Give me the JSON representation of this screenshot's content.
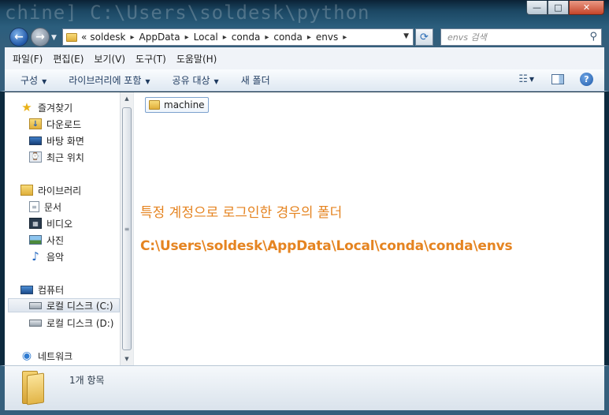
{
  "window": {
    "ghost_title": "chine] C:\\Users\\soldesk\\python",
    "controls": {
      "minimize": "—",
      "maximize": "□",
      "close": "✕"
    }
  },
  "address": {
    "crumbs": [
      "«",
      "soldesk",
      "AppData",
      "Local",
      "conda",
      "conda",
      "envs"
    ],
    "search_placeholder": "envs 검색"
  },
  "menu": [
    "파일(F)",
    "편집(E)",
    "보기(V)",
    "도구(T)",
    "도움말(H)"
  ],
  "toolbar": {
    "organize": "구성",
    "include_library": "라이브러리에 포함",
    "share_with": "공유 대상",
    "new_folder": "새 폴더"
  },
  "navigation": {
    "favorites": {
      "label": "즐겨찾기",
      "items": [
        "다운로드",
        "바탕 화면",
        "최근 위치"
      ]
    },
    "libraries": {
      "label": "라이브러리",
      "items": [
        "문서",
        "비디오",
        "사진",
        "음악"
      ]
    },
    "computer": {
      "label": "컴퓨터",
      "items": [
        "로컬 디스크 (C:)",
        "로컬 디스크 (D:)"
      ],
      "selected": "로컬 디스크 (C:)"
    },
    "network": {
      "label": "네트워크"
    }
  },
  "files": [
    {
      "name": "machine",
      "type": "folder"
    }
  ],
  "annotations": {
    "line1": "특정 계정으로 로그인한 경우의 폴더",
    "line2": "C:\\Users\\soldesk\\AppData\\Local\\conda\\conda\\envs",
    "color": "#e58421"
  },
  "details": {
    "count": "1개 항목"
  }
}
